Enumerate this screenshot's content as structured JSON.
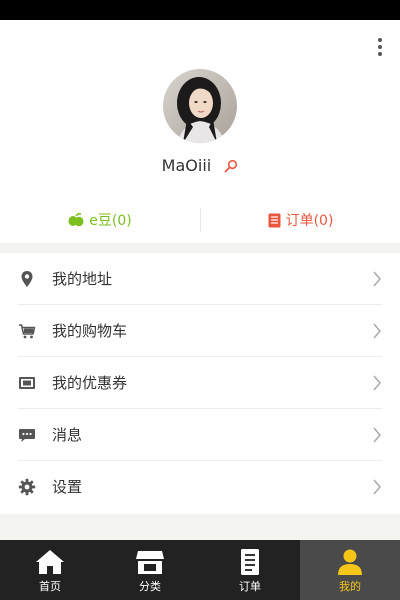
{
  "profile": {
    "username": "MaOiii"
  },
  "stats": {
    "beans_label": "e豆(0)",
    "orders_label": "订单(0)"
  },
  "menu": {
    "items": [
      {
        "label": "我的地址",
        "icon": "location-pin-icon"
      },
      {
        "label": "我的购物车",
        "icon": "cart-icon"
      },
      {
        "label": "我的优惠券",
        "icon": "coupon-icon"
      },
      {
        "label": "消息",
        "icon": "message-icon"
      },
      {
        "label": "设置",
        "icon": "gear-icon"
      }
    ]
  },
  "tabs": [
    {
      "label": "首页",
      "icon": "home-icon",
      "active": false
    },
    {
      "label": "分类",
      "icon": "store-icon",
      "active": false
    },
    {
      "label": "订单",
      "icon": "document-icon",
      "active": false
    },
    {
      "label": "我的",
      "icon": "user-icon",
      "active": true
    }
  ],
  "colors": {
    "beans": "#7cbf1e",
    "orders": "#e9573f",
    "tab_bar": "#222222",
    "tab_active_bg": "#4a4a4a",
    "tab_active_text": "#f5c518"
  }
}
